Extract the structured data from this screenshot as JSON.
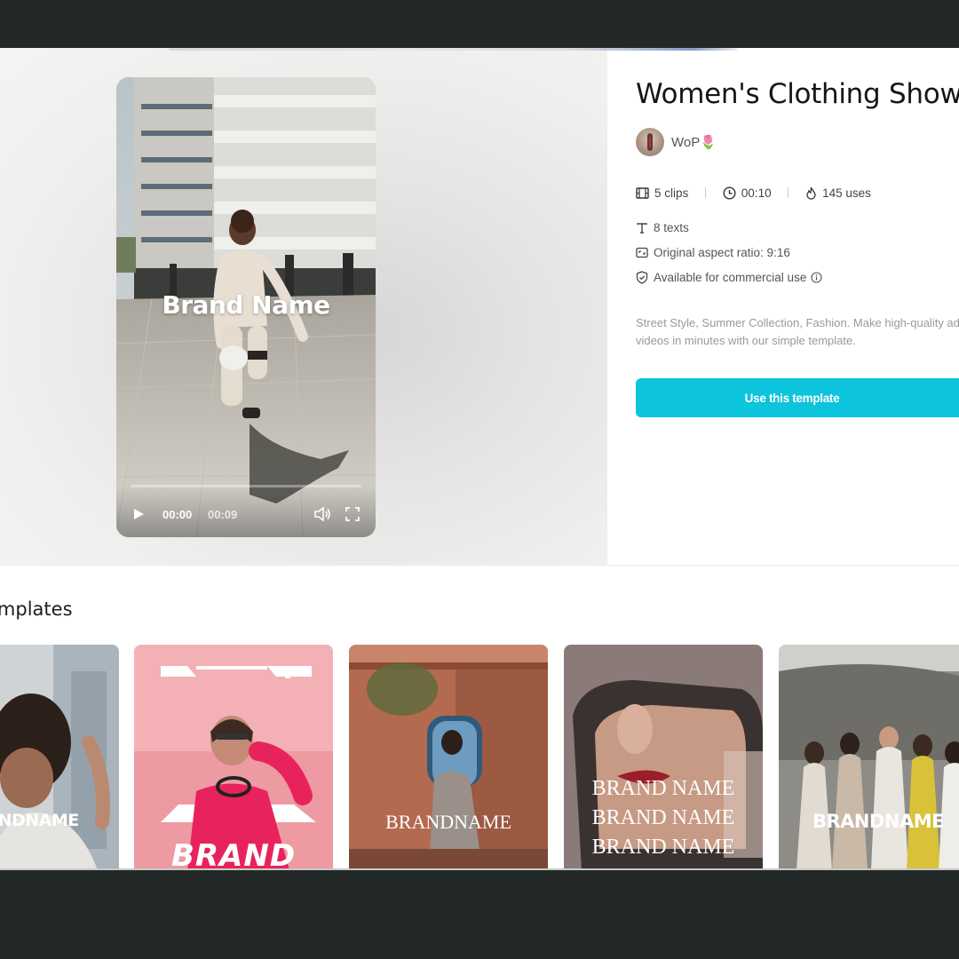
{
  "template": {
    "title": "Women's Clothing Show",
    "author": "WoP🌷",
    "stats": {
      "clips": "5 clips",
      "duration": "00:10",
      "uses": "145 uses"
    },
    "texts": "8 texts",
    "aspect_ratio": "Original aspect ratio: 9:16",
    "commercial": "Available for commercial use",
    "description": "Street Style, Summer Collection, Fashion. Make high-quality ad videos in minutes with our simple template.",
    "cta": "Use this template"
  },
  "player": {
    "overlay_text": "Brand Name",
    "current_time": "00:00",
    "total_time": "00:09",
    "progress": 0.0
  },
  "related": {
    "heading": "emplates",
    "cards": [
      {
        "label": "BRANDNAME"
      },
      {
        "label": "BRAND"
      },
      {
        "label": "BRANDNAME"
      },
      {
        "label_lines": [
          "BRAND NAME",
          "BRAND NAME",
          "BRAND NAME"
        ]
      },
      {
        "label": "BRANDNAME"
      }
    ]
  },
  "colors": {
    "accent": "#0cc4dc",
    "frame": "#232926"
  },
  "icons": [
    "play-icon",
    "volume-icon",
    "fullscreen-icon",
    "film-icon",
    "clock-icon",
    "flame-icon",
    "text-icon",
    "aspect-ratio-icon",
    "shield-check-icon",
    "info-icon"
  ]
}
